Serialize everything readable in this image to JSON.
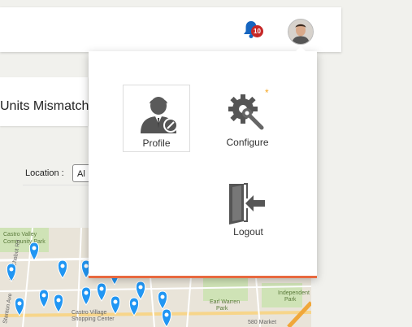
{
  "topbar": {
    "notifications": {
      "icon": "bell-icon",
      "count": "10"
    },
    "user_avatar": {
      "icon": "avatar"
    }
  },
  "background_panel": {
    "title": "Units Mismatch"
  },
  "filter": {
    "location_label": "Location :",
    "location_value": "Al"
  },
  "map": {
    "labels": [
      "Castro Valley",
      "Community Park",
      "Lake Chabot Rd",
      "Stanton Ave",
      "Castro Village",
      "Shopping Center",
      "Earl Warren",
      "Park",
      "Independent",
      "Park",
      "580 Market"
    ]
  },
  "dropdown": {
    "items": [
      {
        "label": "Profile",
        "icon": "user-edit-icon"
      },
      {
        "label": "Configure",
        "icon": "gear-wrench-icon"
      },
      {
        "label": "Logout",
        "icon": "logout-door-icon"
      }
    ],
    "accent_color": "#e8693f"
  },
  "colors": {
    "bell": "#1565c0",
    "badge": "#c62828",
    "pin": "#2196f3",
    "new_indicator": "#f5a623"
  }
}
